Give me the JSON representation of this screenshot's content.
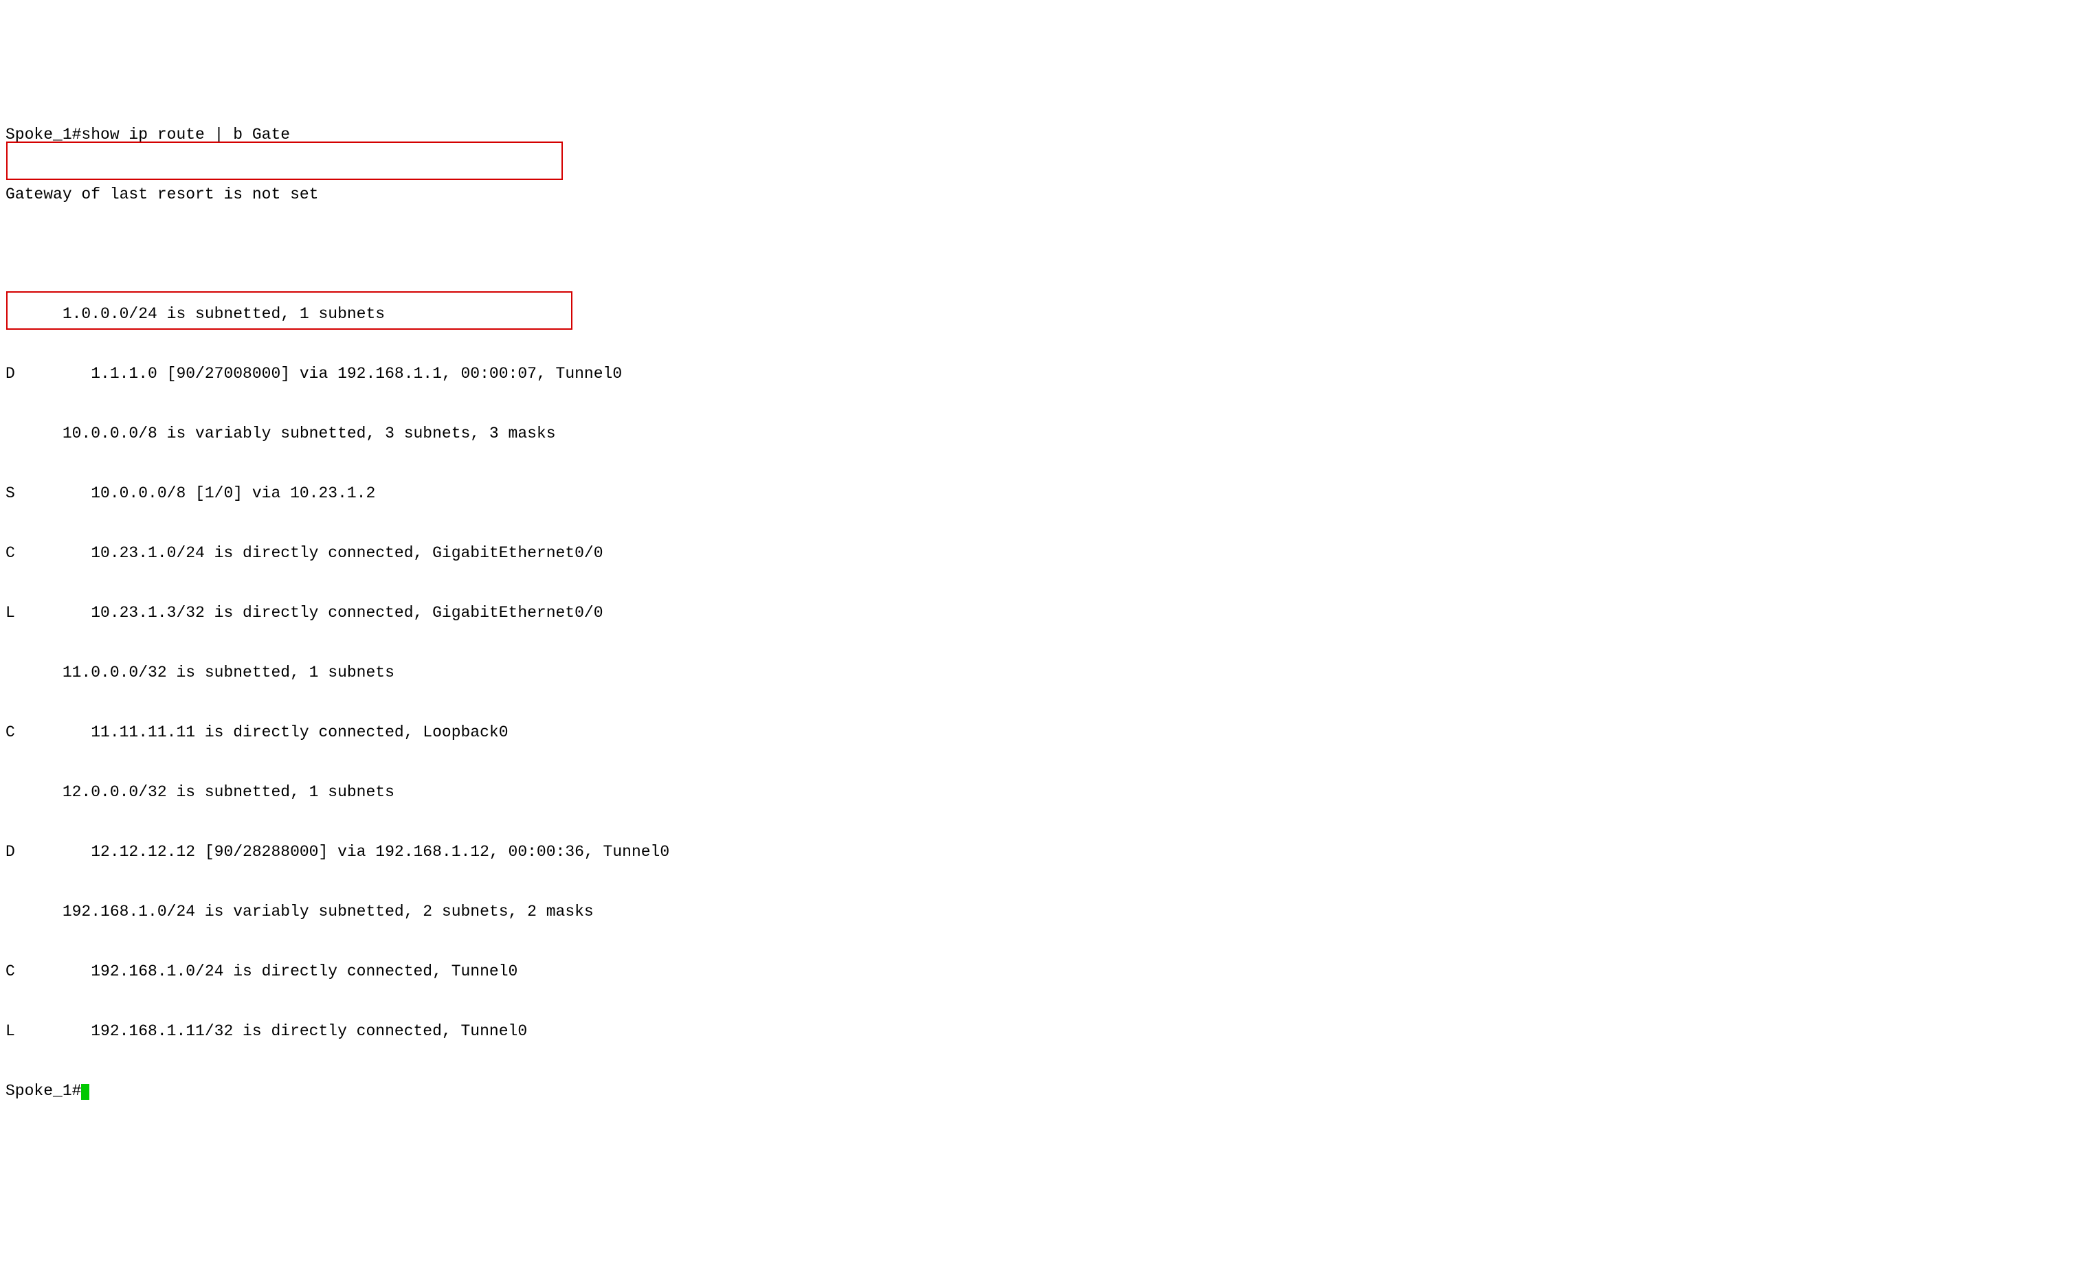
{
  "terminal": {
    "prompt_line": "Spoke_1#show ip route | b Gate",
    "gateway_line": "Gateway of last resort is not set",
    "routes": [
      "      1.0.0.0/24 is subnetted, 1 subnets",
      "D        1.1.1.0 [90/27008000] via 192.168.1.1, 00:00:07, Tunnel0",
      "      10.0.0.0/8 is variably subnetted, 3 subnets, 3 masks",
      "S        10.0.0.0/8 [1/0] via 10.23.1.2",
      "C        10.23.1.0/24 is directly connected, GigabitEthernet0/0",
      "L        10.23.1.3/32 is directly connected, GigabitEthernet0/0",
      "      11.0.0.0/32 is subnetted, 1 subnets",
      "C        11.11.11.11 is directly connected, Loopback0",
      "      12.0.0.0/32 is subnetted, 1 subnets",
      "D        12.12.12.12 [90/28288000] via 192.168.1.12, 00:00:36, Tunnel0",
      "      192.168.1.0/24 is variably subnetted, 2 subnets, 2 masks",
      "C        192.168.1.0/24 is directly connected, Tunnel0",
      "L        192.168.1.11/32 is directly connected, Tunnel0"
    ],
    "final_prompt": "Spoke_1#"
  }
}
